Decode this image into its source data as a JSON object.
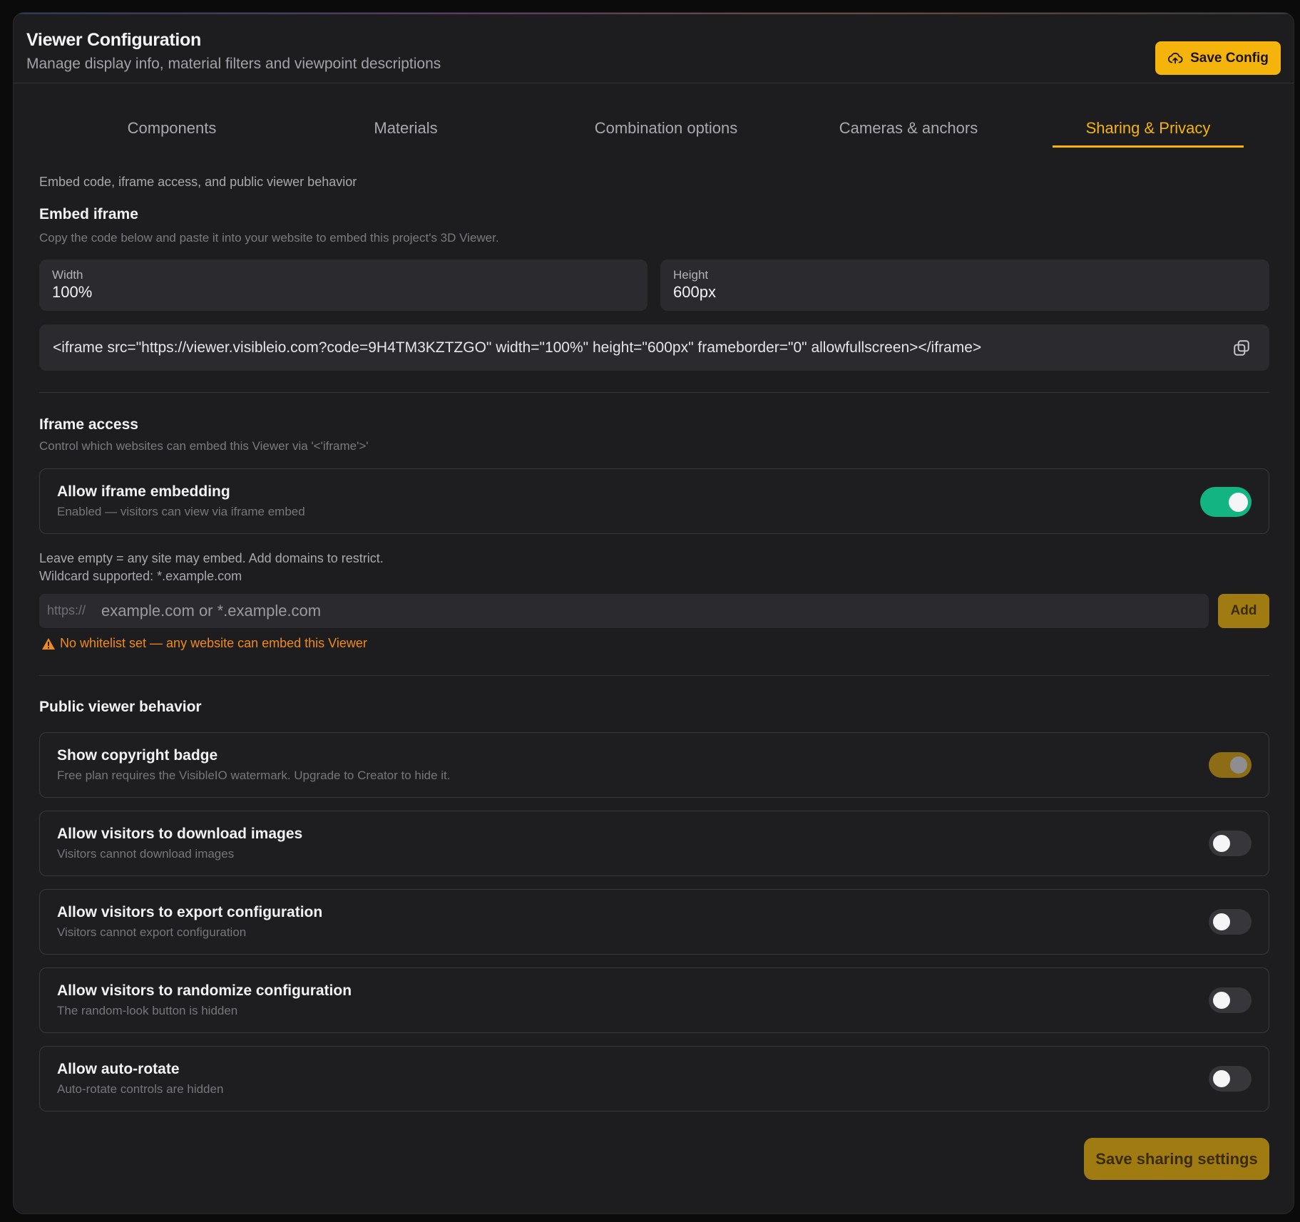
{
  "header": {
    "title": "Viewer Configuration",
    "subtitle": "Manage display info, material filters and viewpoint descriptions",
    "save_label": "Save Config"
  },
  "tabs": [
    {
      "label": "Components",
      "active": false
    },
    {
      "label": "Materials",
      "active": false
    },
    {
      "label": "Combination options",
      "active": false
    },
    {
      "label": "Cameras & anchors",
      "active": false
    },
    {
      "label": "Sharing & Privacy",
      "active": true
    }
  ],
  "intro": "Embed code, iframe access, and public viewer behavior",
  "embed": {
    "title": "Embed iframe",
    "description": "Copy the code below and paste it into your website to embed this project's 3D Viewer.",
    "width_label": "Width",
    "width_value": "100%",
    "height_label": "Height",
    "height_value": "600px",
    "code": "<iframe src=\"https://viewer.visibleio.com?code=9H4TM3KZTZGO\" width=\"100%\" height=\"600px\" frameborder=\"0\" allowfullscreen></iframe>"
  },
  "iframe_access": {
    "title": "Iframe access",
    "description": "Control which websites can embed this Viewer via '<'iframe'>'",
    "allow_title": "Allow iframe embedding",
    "allow_desc": "Enabled — visitors can view via iframe embed",
    "allow_on": true,
    "hint_line1": "Leave empty = any site may embed. Add domains to restrict.",
    "hint_line2": "Wildcard supported: *.example.com",
    "prefix": "https://",
    "placeholder": "example.com or *.example.com",
    "add_label": "Add",
    "warning": "No whitelist set — any website can embed this Viewer"
  },
  "public_viewer": {
    "title": "Public viewer behavior",
    "items": [
      {
        "title": "Show copyright badge",
        "desc": "Free plan requires the VisibleIO watermark. Upgrade to Creator to hide it.",
        "state": "locked"
      },
      {
        "title": "Allow visitors to download images",
        "desc": "Visitors cannot download images",
        "state": "off"
      },
      {
        "title": "Allow visitors to export configuration",
        "desc": "Visitors cannot export configuration",
        "state": "off"
      },
      {
        "title": "Allow visitors to randomize configuration",
        "desc": "The random-look button is hidden",
        "state": "off"
      },
      {
        "title": "Allow auto-rotate",
        "desc": "Auto-rotate controls are hidden",
        "state": "off"
      }
    ]
  },
  "footer": {
    "save_label": "Save sharing settings"
  },
  "colors": {
    "accent": "#f4b40b",
    "toggle_on": "#12b482",
    "warning": "#f08a1c",
    "panel_bg": "#1d1d20"
  }
}
